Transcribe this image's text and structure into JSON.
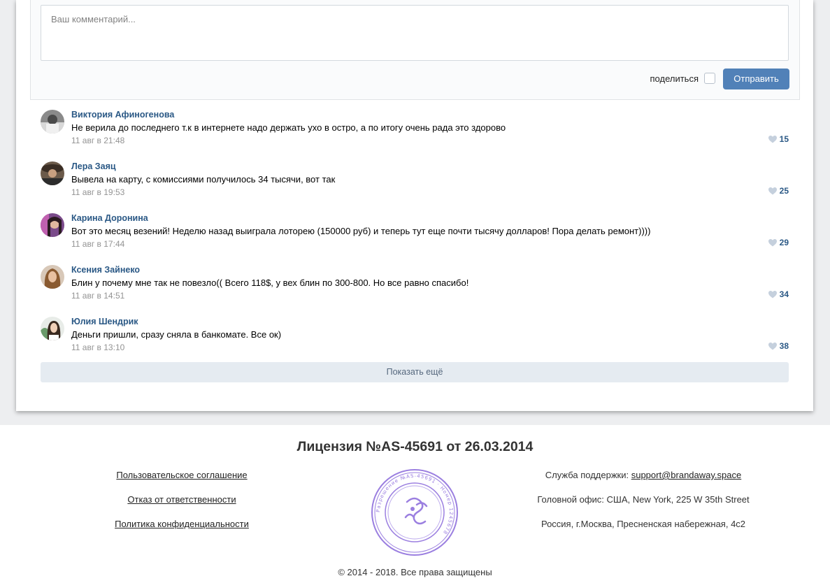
{
  "composer": {
    "placeholder": "Ваш комментарий...",
    "share_label": "поделиться",
    "send_label": "Отправить"
  },
  "comments": [
    {
      "author": "Виктория Афиногенова",
      "text": "Не верила до последнего т.к в интернете надо держать ухо в остро, а по итогу очень рада это здорово",
      "date": "11 авг в 21:48",
      "likes": "15"
    },
    {
      "author": "Лера Заяц",
      "text": "Вывела на карту, с комиссиями получилось 34 тысячи, вот так",
      "date": "11 авг в 19:53",
      "likes": "25"
    },
    {
      "author": "Карина Доронина",
      "text": "Вот это месяц везений! Неделю назад выиграла лоторею (150000 руб) и теперь тут еще почти тысячу долларов! Пора делать ремонт))))",
      "date": "11 авг в 17:44",
      "likes": "29"
    },
    {
      "author": "Ксения Зайнеко",
      "text": "Блин у почему мне так не повезло(( Всего 118$, у вех блин по 300-800. Но все равно спасибо!",
      "date": "11 авг в 14:51",
      "likes": "34"
    },
    {
      "author": "Юлия Шендрик",
      "text": "Деньги пришли, сразу сняла в банкомате. Все ок)",
      "date": "11 авг в 13:10",
      "likes": "38"
    }
  ],
  "show_more_label": "Показать ещё",
  "footer": {
    "license": "Лицензия №AS-45691 от 26.03.2014",
    "links": [
      "Пользовательское соглашение",
      "Отказ от ответственности",
      "Политика конфиденциальности"
    ],
    "support_label": "Служба поддержки: ",
    "support_email": "support@brandaway.space",
    "office_us": "Головной офис: США, New York, 225 W 35th Street",
    "office_ru": "Россия, г.Москва, Пресненская набережная, 4с2",
    "stamp_text": "Разрешение №AS-45691 · Номер 1245678",
    "copyright": "© 2014 - 2018. Все права защищены"
  },
  "colors": {
    "accent": "#5181b8",
    "author_link": "#2a5885",
    "stamp": "#9b7fe0"
  }
}
